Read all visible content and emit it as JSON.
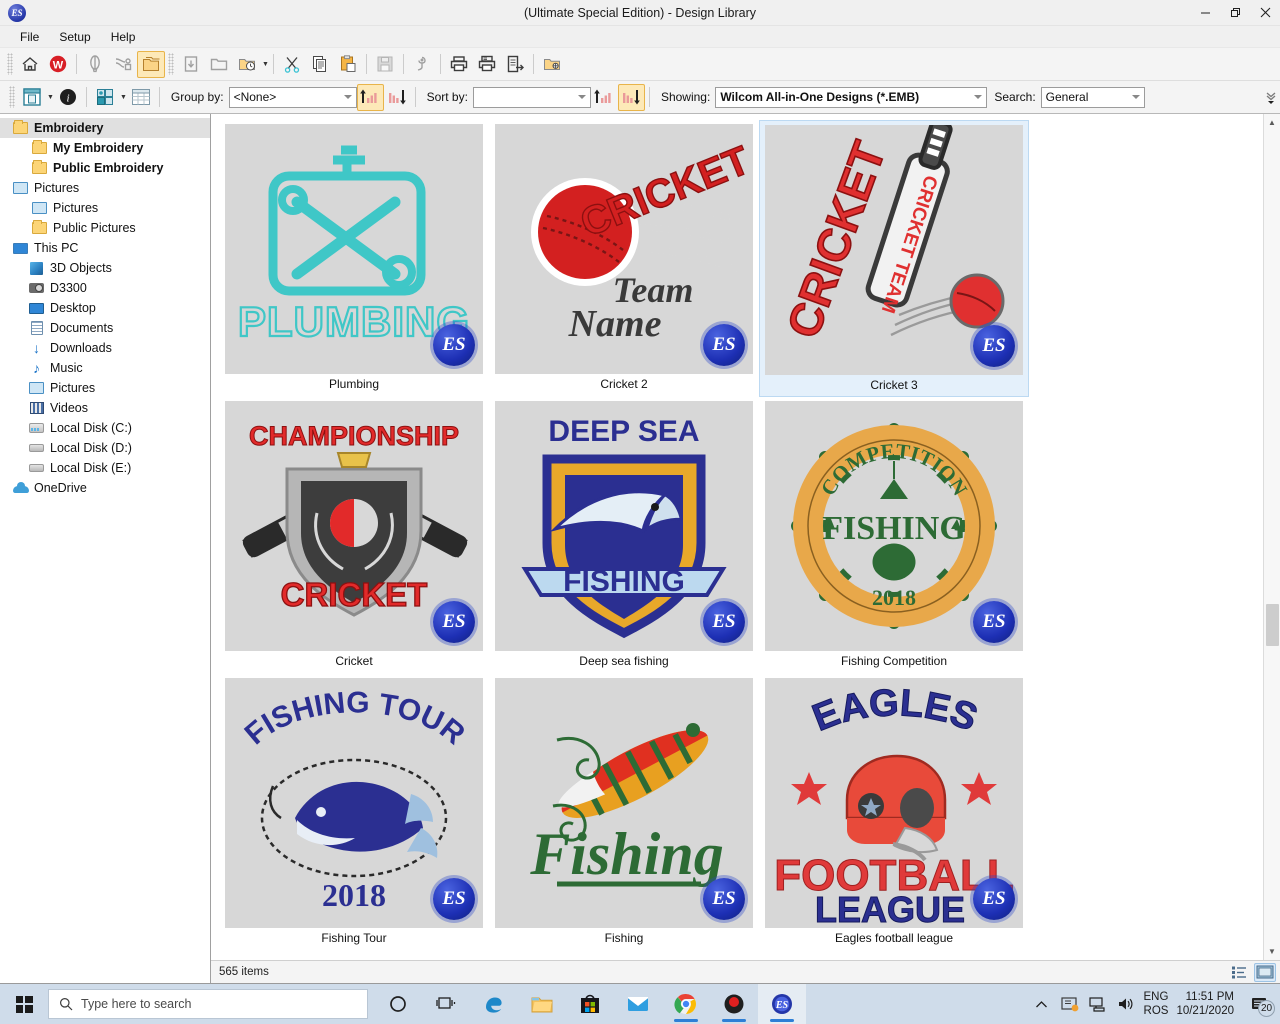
{
  "window": {
    "title": "(Ultimate Special Edition) - Design Library",
    "app_icon": "es-logo-icon",
    "minimize": "–",
    "restore": "❐",
    "close": "✕"
  },
  "menu": {
    "items": [
      "File",
      "Setup",
      "Help"
    ]
  },
  "toolbar_main": {
    "buttons": [
      {
        "name": "home-icon",
        "title": "Home"
      },
      {
        "name": "wilcom-logo-icon",
        "title": "Wilcom"
      },
      {
        "name": "corel-balloon-icon",
        "title": "CorelDRAW Graphics"
      },
      {
        "name": "design-convert-icon",
        "title": "Convert"
      },
      {
        "name": "design-library-icon",
        "title": "Design Library"
      },
      {
        "name": "insert-design-icon",
        "title": "Insert Design"
      },
      {
        "name": "open-folder-icon",
        "title": "Open"
      },
      {
        "name": "recent-folder-icon",
        "title": "Recent"
      },
      {
        "name": "cut-icon",
        "title": "Cut"
      },
      {
        "name": "copy-icon",
        "title": "Copy"
      },
      {
        "name": "paste-icon",
        "title": "Paste"
      },
      {
        "name": "save-icon",
        "title": "Save"
      },
      {
        "name": "stitch-player-icon",
        "title": "Stitch Player"
      },
      {
        "name": "print-icon",
        "title": "Print"
      },
      {
        "name": "print-preview-icon",
        "title": "Print Preview"
      },
      {
        "name": "export-icon",
        "title": "Export"
      },
      {
        "name": "browse-folder-icon",
        "title": "Browse"
      }
    ]
  },
  "toolbar_view": {
    "view_mode_label": "thumbnail-view-icon",
    "info_label": "info-icon",
    "arrange_label": "arrange-icon",
    "table_label": "table-view-icon",
    "group_by_label": "Group by:",
    "group_by_value": "<None>",
    "sort_by_label": "Sort by:",
    "sort_by_value": "",
    "sort_ascending_icon": "sort-ascending-icon",
    "sort_descending_icon": "sort-descending-icon",
    "showing_label": "Showing:",
    "showing_value": "Wilcom All-in-One Designs (*.EMB)",
    "search_label": "Search:",
    "search_value": "General",
    "overflow_icon": "toolbar-overflow-icon"
  },
  "sidebar": {
    "items": [
      {
        "label": "Embroidery",
        "icon": "folder-icon",
        "indent": 0,
        "bold": true,
        "selected": true
      },
      {
        "label": "My Embroidery",
        "icon": "folder-icon",
        "indent": 1,
        "bold": true,
        "selected": false
      },
      {
        "label": "Public Embroidery",
        "icon": "folder-icon",
        "indent": 1,
        "bold": true,
        "selected": false
      },
      {
        "label": "Pictures",
        "icon": "library-icon",
        "indent": 0,
        "bold": false,
        "selected": false
      },
      {
        "label": "Pictures",
        "icon": "library-icon",
        "indent": 1,
        "bold": false,
        "selected": false
      },
      {
        "label": "Public Pictures",
        "icon": "folder-icon",
        "indent": 1,
        "bold": false,
        "selected": false
      },
      {
        "label": "This PC",
        "icon": "monitor-icon",
        "indent": 0,
        "bold": false,
        "selected": false
      },
      {
        "label": "3D Objects",
        "icon": "cube-icon",
        "indent": 2,
        "bold": false,
        "selected": false
      },
      {
        "label": "D3300",
        "icon": "camera-icon",
        "indent": 2,
        "bold": false,
        "selected": false
      },
      {
        "label": "Desktop",
        "icon": "desktop-icon",
        "indent": 2,
        "bold": false,
        "selected": false
      },
      {
        "label": "Documents",
        "icon": "document-icon",
        "indent": 2,
        "bold": false,
        "selected": false
      },
      {
        "label": "Downloads",
        "icon": "download-icon",
        "indent": 2,
        "bold": false,
        "selected": false
      },
      {
        "label": "Music",
        "icon": "music-icon",
        "indent": 2,
        "bold": false,
        "selected": false
      },
      {
        "label": "Pictures",
        "icon": "library-icon",
        "indent": 2,
        "bold": false,
        "selected": false
      },
      {
        "label": "Videos",
        "icon": "video-icon",
        "indent": 2,
        "bold": false,
        "selected": false
      },
      {
        "label": "Local Disk (C:)",
        "icon": "system-disk-icon",
        "indent": 2,
        "bold": false,
        "selected": false
      },
      {
        "label": "Local Disk (D:)",
        "icon": "disk-icon",
        "indent": 2,
        "bold": false,
        "selected": false
      },
      {
        "label": "Local Disk (E:)",
        "icon": "disk-icon",
        "indent": 2,
        "bold": false,
        "selected": false
      },
      {
        "label": "OneDrive",
        "icon": "cloud-icon",
        "indent": 0,
        "bold": false,
        "selected": false
      }
    ]
  },
  "designs": [
    {
      "label": "Plumbing",
      "selected": false,
      "badge": "ES"
    },
    {
      "label": "Cricket 2",
      "selected": false,
      "badge": "ES"
    },
    {
      "label": "Cricket 3",
      "selected": true,
      "badge": "ES"
    },
    {
      "label": "Cricket",
      "selected": false,
      "badge": "ES"
    },
    {
      "label": "Deep sea fishing",
      "selected": false,
      "badge": "ES"
    },
    {
      "label": "Fishing Competition",
      "selected": false,
      "badge": "ES"
    },
    {
      "label": "Fishing Tour",
      "selected": false,
      "badge": "ES"
    },
    {
      "label": "Fishing",
      "selected": false,
      "badge": "ES"
    },
    {
      "label": "Eagles football league",
      "selected": false,
      "badge": "ES"
    }
  ],
  "design_art": {
    "plumbing": {
      "title": "PLUMBING",
      "color": "#3fc7c7"
    },
    "cricket2": {
      "title": "CRICKET",
      "line1": "Team",
      "line2": "Name",
      "color": "#d32020"
    },
    "cricket3": {
      "title": "CRICKET",
      "bat_text": "CRICKET TEAM",
      "color": "#e03030"
    },
    "cricket": {
      "top": "CHAMPIONSHIP",
      "bottom": "CRICKET",
      "color": "#e22a2a"
    },
    "deepsea": {
      "top": "DEEP SEA",
      "banner": "FISHING",
      "color": "#2b2f91"
    },
    "fishcomp": {
      "ring": "COMPETITION",
      "center": "FISHING",
      "year": "2018",
      "color": "#2d6b35"
    },
    "fishtour": {
      "top": "FISHING  TOUR",
      "year": "2018",
      "color": "#2b2f91"
    },
    "fishing": {
      "script": "Fishing",
      "color": "#2d6b35"
    },
    "eagles": {
      "top": "EAGLES",
      "mid": "FOOTBALL",
      "bottom": "LEAGUE",
      "color": "#2b2f91"
    }
  },
  "status": {
    "items_text": "565 items",
    "list_view_icon": "list-view-icon",
    "thumbnail_view_icon": "thumbnail-view-icon"
  },
  "taskbar": {
    "start_icon": "windows-start-icon",
    "search_placeholder": "Type here to search",
    "search_icon": "search-icon",
    "icons": [
      {
        "name": "cortana-icon",
        "open": false,
        "active": false
      },
      {
        "name": "task-view-icon",
        "open": false,
        "active": false
      },
      {
        "name": "edge-icon",
        "open": false,
        "active": false
      },
      {
        "name": "file-explorer-icon",
        "open": false,
        "active": false
      },
      {
        "name": "microsoft-store-icon",
        "open": false,
        "active": false
      },
      {
        "name": "mail-icon",
        "open": false,
        "active": false
      },
      {
        "name": "chrome-icon",
        "open": true,
        "active": false
      },
      {
        "name": "recorder-icon",
        "open": true,
        "active": false
      },
      {
        "name": "wilcom-es-icon",
        "open": true,
        "active": true
      }
    ],
    "tray": {
      "chevron_icon": "show-hidden-icons-icon",
      "onedrive_icon": "onedrive-tray-icon",
      "network_icon": "network-tray-icon",
      "volume_icon": "volume-tray-icon",
      "lang_line1": "ENG",
      "lang_line2": "ROS",
      "time": "11:51 PM",
      "date": "10/21/2020",
      "notification_icon": "action-center-icon",
      "notification_count": "20"
    }
  }
}
